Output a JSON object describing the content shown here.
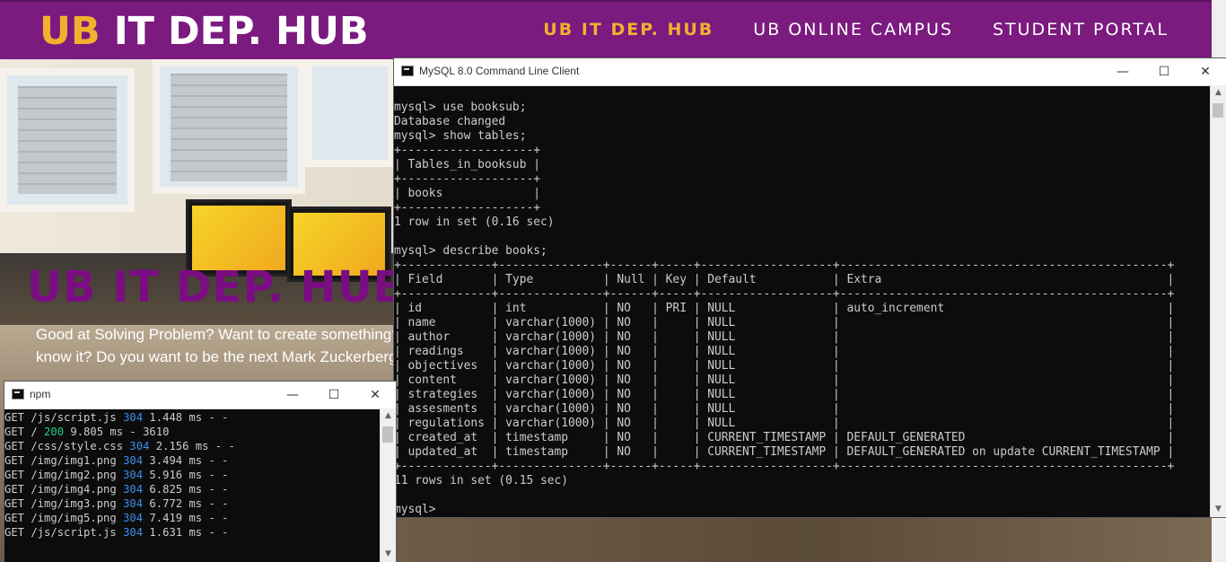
{
  "site": {
    "brand_accent": "UB",
    "brand_rest": "IT DEP. HUB",
    "nav": [
      {
        "label": "UB IT DEP. HUB",
        "active": true
      },
      {
        "label": "UB ONLINE CAMPUS",
        "active": false
      },
      {
        "label": "STUDENT PORTAL",
        "active": false
      }
    ],
    "hero_title": "UB IT DEP. HUB",
    "hero_line1": "Good at Solving Problem? Want to create something?",
    "hero_line2": "know it? Do you want to be the next Mark Zuckerberg?",
    "colors": {
      "brand_purple": "#7b1a7f",
      "accent_gold": "#f2b02e"
    }
  },
  "mysql_window": {
    "title": "MySQL 8.0 Command Line Client",
    "icon": "console-icon",
    "lines": [
      "mysql> use booksub;",
      "Database changed",
      "mysql> show tables;",
      "+-------------------+",
      "| Tables_in_booksub |",
      "+-------------------+",
      "| books             |",
      "+-------------------+",
      "1 row in set (0.16 sec)",
      "",
      "mysql> describe books;",
      "+-------------+---------------+------+-----+-------------------+-----------------------------------------------+",
      "| Field       | Type          | Null | Key | Default           | Extra                                         |",
      "+-------------+---------------+------+-----+-------------------+-----------------------------------------------+",
      "| id          | int           | NO   | PRI | NULL              | auto_increment                                |",
      "| name        | varchar(1000) | NO   |     | NULL              |                                               |",
      "| author      | varchar(1000) | NO   |     | NULL              |                                               |",
      "| readings    | varchar(1000) | NO   |     | NULL              |                                               |",
      "| objectives  | varchar(1000) | NO   |     | NULL              |                                               |",
      "| content     | varchar(1000) | NO   |     | NULL              |                                               |",
      "| strategies  | varchar(1000) | NO   |     | NULL              |                                               |",
      "| assesments  | varchar(1000) | NO   |     | NULL              |                                               |",
      "| regulations | varchar(1000) | NO   |     | NULL              |                                               |",
      "| created_at  | timestamp     | NO   |     | CURRENT_TIMESTAMP | DEFAULT_GENERATED                             |",
      "| updated_at  | timestamp     | NO   |     | CURRENT_TIMESTAMP | DEFAULT_GENERATED on update CURRENT_TIMESTAMP |",
      "+-------------+---------------+------+-----+-------------------+-----------------------------------------------+",
      "11 rows in set (0.15 sec)",
      "",
      "mysql>"
    ]
  },
  "npm_window": {
    "title": "npm",
    "icon": "console-icon",
    "log": [
      {
        "method": "GET",
        "path": "/js/script.js",
        "status": "304",
        "rest": "1.448 ms - -"
      },
      {
        "method": "GET",
        "path": "/",
        "status": "200",
        "rest": "9.805 ms - 3610"
      },
      {
        "method": "GET",
        "path": "/css/style.css",
        "status": "304",
        "rest": "2.156 ms - -"
      },
      {
        "method": "GET",
        "path": "/img/img1.png",
        "status": "304",
        "rest": "3.494 ms - -"
      },
      {
        "method": "GET",
        "path": "/img/img2.png",
        "status": "304",
        "rest": "5.916 ms - -"
      },
      {
        "method": "GET",
        "path": "/img/img4.png",
        "status": "304",
        "rest": "6.825 ms - -"
      },
      {
        "method": "GET",
        "path": "/img/img3.png",
        "status": "304",
        "rest": "6.772 ms - -"
      },
      {
        "method": "GET",
        "path": "/img/img5.png",
        "status": "304",
        "rest": "7.419 ms - -"
      },
      {
        "method": "GET",
        "path": "/js/script.js",
        "status": "304",
        "rest": "1.631 ms - -"
      }
    ],
    "status_colors": {
      "200": "#23d18b",
      "304": "#3b8eea"
    }
  },
  "window_controls": {
    "minimize": "—",
    "maximize": "☐",
    "close": "✕"
  }
}
